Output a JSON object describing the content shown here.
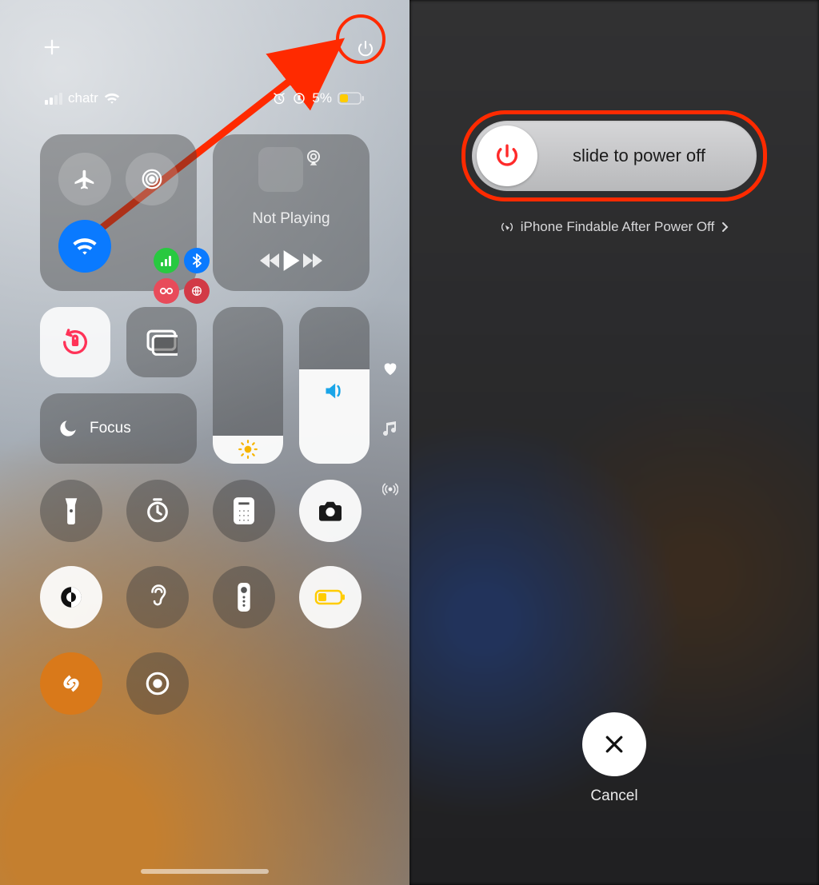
{
  "left": {
    "status": {
      "carrier": "chatr",
      "battery_pct": "5%"
    },
    "media": {
      "title": "Not Playing"
    },
    "focus": {
      "label": "Focus"
    },
    "brightness_pct": 18,
    "volume_pct": 60
  },
  "right": {
    "slider_label": "slide to power off",
    "findable_label": "iPhone Findable After Power Off",
    "cancel_label": "Cancel"
  }
}
